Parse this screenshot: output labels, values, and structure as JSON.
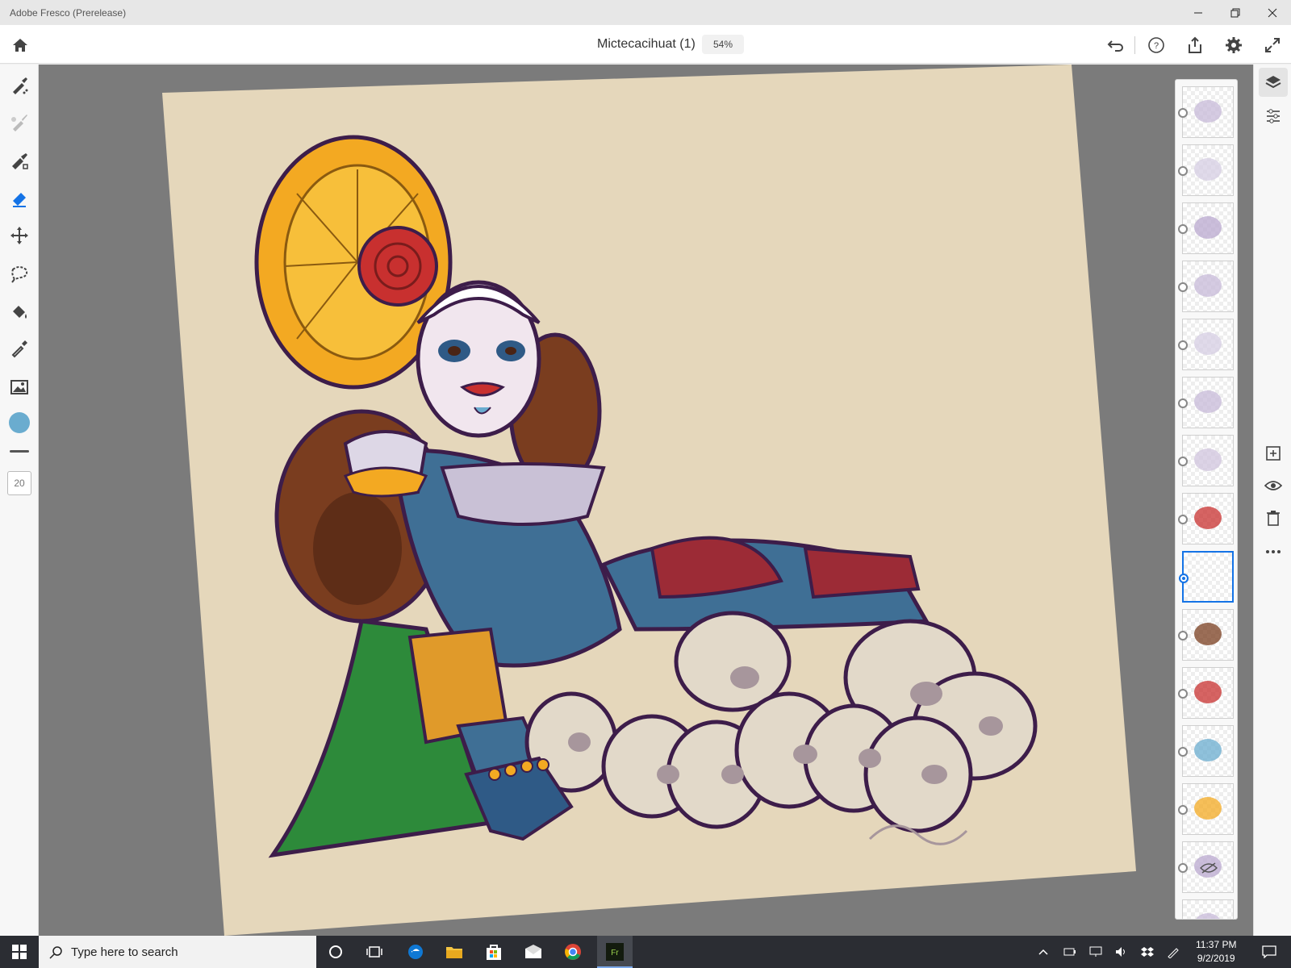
{
  "window": {
    "title": "Adobe Fresco (Prerelease)",
    "controls": [
      "minimize-icon",
      "maximize-icon",
      "close-icon"
    ]
  },
  "appbar": {
    "document_name": "Mictecacihuat (1)",
    "zoom": "54%",
    "icons": [
      "home-icon",
      "undo-icon",
      "help-icon",
      "share-icon",
      "settings-icon",
      "fullscreen-icon"
    ]
  },
  "toolbar": {
    "tools": [
      "pixel-brush-icon",
      "live-brush-icon",
      "vector-brush-icon",
      "eraser-icon",
      "transform-icon",
      "selection-icon",
      "fill-icon",
      "eyedropper-icon",
      "image-icon"
    ],
    "active_tool": "eraser-icon",
    "current_color": "#6aaccf",
    "brush_size": "20"
  },
  "layers_panel": {
    "layer_count_visible": 15,
    "selected_index": 8,
    "hidden_index": 13,
    "actions": [
      "add-layer-icon",
      "visibility-icon",
      "delete-layer-icon",
      "more-icon"
    ]
  },
  "right_panel": {
    "icons": [
      "layers-icon",
      "properties-icon"
    ]
  },
  "taskbar": {
    "search_placeholder": "Type here to search",
    "time": "11:37 PM",
    "date": "9/2/2019"
  },
  "colors": {
    "canvas_paper": "#e5d7bb",
    "workspace": "#7b7b7b",
    "accent": "#1473e6"
  }
}
